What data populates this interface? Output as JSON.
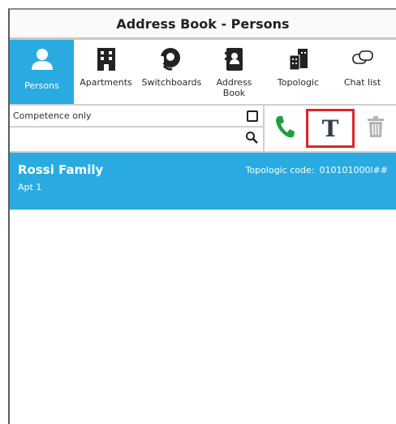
{
  "window": {
    "title": "Address Book - Persons"
  },
  "tabs": [
    {
      "label": "Persons",
      "icon": "person-icon",
      "active": true
    },
    {
      "label": "Apartments",
      "icon": "building-icon",
      "active": false
    },
    {
      "label": "Switchboards",
      "icon": "headset-icon",
      "active": false
    },
    {
      "label": "Address Book",
      "icon": "address-book-icon",
      "active": false
    },
    {
      "label": "Topologic",
      "icon": "buildings-icon",
      "active": false
    },
    {
      "label": "Chat list",
      "icon": "chat-icon",
      "active": false
    }
  ],
  "filters": {
    "competence_label": "Competence only",
    "competence_checked": false,
    "search_value": "",
    "search_placeholder": ""
  },
  "actions": {
    "call": {
      "icon": "phone-icon",
      "color": "#1f9e3a"
    },
    "topologic": {
      "glyph": "T",
      "icon": "topologic-t-icon",
      "highlight_color": "#e0242a"
    },
    "delete": {
      "icon": "trash-icon",
      "color": "#b5b5b5"
    }
  },
  "list": [
    {
      "name": "Rossi Family",
      "apartment": "Apt 1",
      "topologic_label": "Topologic code:",
      "topologic_code": "010101000l##"
    }
  ],
  "colors": {
    "accent": "#29abe2"
  }
}
